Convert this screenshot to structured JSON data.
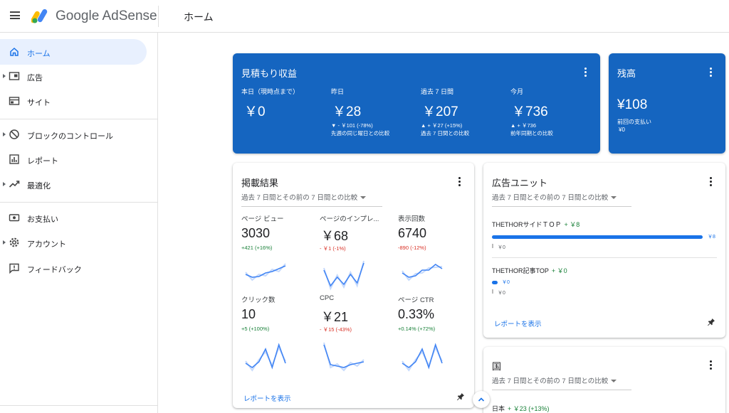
{
  "header": {
    "brand": "Google AdSense",
    "page_title": "ホーム"
  },
  "sidebar": {
    "items": [
      {
        "label": "ホーム",
        "icon": "home-icon"
      },
      {
        "label": "広告",
        "icon": "ads-icon"
      },
      {
        "label": "サイト",
        "icon": "sites-icon"
      },
      {
        "label": "ブロックのコントロール",
        "icon": "block-icon"
      },
      {
        "label": "レポート",
        "icon": "reports-icon"
      },
      {
        "label": "最適化",
        "icon": "trending-icon"
      },
      {
        "label": "お支払い",
        "icon": "payments-icon"
      },
      {
        "label": "アカウント",
        "icon": "gear-icon"
      },
      {
        "label": "フィードバック",
        "icon": "feedback-icon"
      }
    ]
  },
  "estimated": {
    "title": "見積もり収益",
    "cols": [
      {
        "label": "本日（現時点まで）",
        "value": "￥0",
        "d1": "",
        "d2": ""
      },
      {
        "label": "昨日",
        "value": "￥28",
        "d1": "▼ - ￥101 (-78%)",
        "d2": "先週の同じ曜日との比較"
      },
      {
        "label": "過去 7 日間",
        "value": "￥207",
        "d1": "▲ + ￥27 (+15%)",
        "d2": "過去 7 日間との比較"
      },
      {
        "label": "今月",
        "value": "￥736",
        "d1": "▲ + ￥736",
        "d2": "前年同期との比較"
      }
    ]
  },
  "balance": {
    "title": "残高",
    "value": "¥108",
    "last_label": "前回の支払い",
    "last_value": "¥0"
  },
  "performance": {
    "title": "掲載結果",
    "range": "過去 7 日間とその前の 7 日間との比較",
    "metrics": [
      {
        "label": "ページ ビュー",
        "value": "3030",
        "delta": "+421 (+16%)",
        "trend": "pos",
        "spark": [
          20,
          24,
          23,
          18,
          16,
          12,
          8
        ]
      },
      {
        "label": "ページのインプレ...",
        "value": "￥68",
        "delta": "- ￥1 (-1%)",
        "trend": "neg",
        "spark": [
          14,
          36,
          24,
          34,
          20,
          32,
          4
        ]
      },
      {
        "label": "表示回数",
        "value": "6740",
        "delta": "-890 (-12%)",
        "trend": "neg",
        "spark": [
          18,
          24,
          22,
          14,
          14,
          6,
          12
        ]
      },
      {
        "label": "クリック数",
        "value": "10",
        "delta": "+5 (+100%)",
        "trend": "pos",
        "spark": [
          30,
          36,
          28,
          10,
          36,
          4,
          30
        ]
      },
      {
        "label": "CPC",
        "value": "￥21",
        "delta": "- ￥15 (-43%)",
        "trend": "neg",
        "spark": [
          4,
          32,
          34,
          36,
          32,
          30,
          28
        ]
      },
      {
        "label": "ページ CTR",
        "value": "0.33%",
        "delta": "+0.14% (+72%)",
        "trend": "pos",
        "spark": [
          30,
          36,
          28,
          10,
          36,
          4,
          30
        ]
      }
    ],
    "report_link": "レポートを表示"
  },
  "ad_units": {
    "title": "広告ユニット",
    "range": "過去 7 日間とその前の 7 日間との比較",
    "items": [
      {
        "name": "THETHORサイドＴＯＰ",
        "delta": "+ ￥8",
        "bar_label": "￥8",
        "bar_fraction": 1.0,
        "prev_label": "￥0"
      },
      {
        "name": "THETHOR記事TOP",
        "delta": "+ ￥0",
        "bar_label": "￥0",
        "bar_fraction": 0.0,
        "prev_label": "￥0"
      }
    ],
    "report_link": "レポートを表示"
  },
  "country": {
    "title": "国",
    "range": "過去 7 日間とその前の 7 日間との比較",
    "first_row": {
      "name": "日本",
      "delta": "+ ￥23 (+13%)"
    }
  },
  "colors": {
    "accent": "#1a73e8",
    "card_blue": "#1565c0",
    "positive": "#188038",
    "negative": "#d93025",
    "spark_current": "#4285f4",
    "spark_previous": "#c6dafc"
  }
}
